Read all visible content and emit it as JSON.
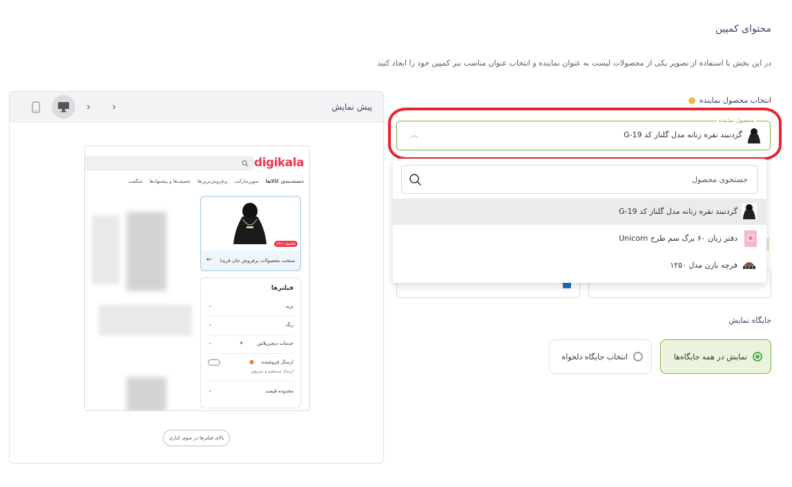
{
  "header": {
    "title": "محتوای کمپین",
    "description": "در این بخش با استفاده از تصویر یکی از محصولات لیست به عنوان نماینده و انتخاب عنوان مناسب بنر کمپین خود را ایجاد کنید"
  },
  "preview": {
    "label": "پیش نمایش",
    "devices": {
      "active": "desktop"
    },
    "mock": {
      "logo": "digikala",
      "nav": [
        "دسته‌بندی کالاها",
        "سوپرمارکت",
        "پرفروش‌ترین‌ها",
        "تخفیف‌ها و پیشنهادها",
        "شگفت"
      ],
      "card_badge": "۱۶٪ تخفیف",
      "card_text": "منتخب محصولات پرفروش جان فریدا",
      "filters_title": "فیلترها",
      "filters": [
        "برند",
        "رنگ",
        "خدمات دیجی‌پلاس",
        "ارسال فروشنده",
        "محدوده قیمت"
      ],
      "seller_sub": "ارسال مستقیم و سریع‌تر",
      "footer_button": "بالای فیلترها در منوی کناری"
    }
  },
  "form": {
    "product_label": "انتخاب محصول نماینده",
    "select_legend": "محصول نماینده",
    "selected_value": "گردنبند نقره زنانه مدل گلناز کد G-19",
    "search_placeholder": "جستجوی محصول",
    "options": [
      {
        "label": "گردنبند نقره زنانه مدل گلناز کد G-19",
        "icon": "necklace-thumb",
        "highlighted": true
      },
      {
        "label": "دفتر زبان ۶۰ برگ سم طرح Unicorn",
        "icon": "notebook-thumb",
        "highlighted": false
      },
      {
        "label": "فرچه بازن مدل ۱۲۵۰",
        "icon": "brush-thumb",
        "highlighted": false
      }
    ],
    "placement_title": "جایگاه نمایش",
    "placement_options": [
      {
        "label": "نمایش در همه جایگاه‌ها",
        "selected": true
      },
      {
        "label": "انتخاب جایگاه دلخواه",
        "selected": false
      }
    ]
  },
  "colors": {
    "accent": "#7cb342",
    "highlight_ring": "#e8232b",
    "brand": "#ef394e",
    "info": "#f4b73e"
  }
}
